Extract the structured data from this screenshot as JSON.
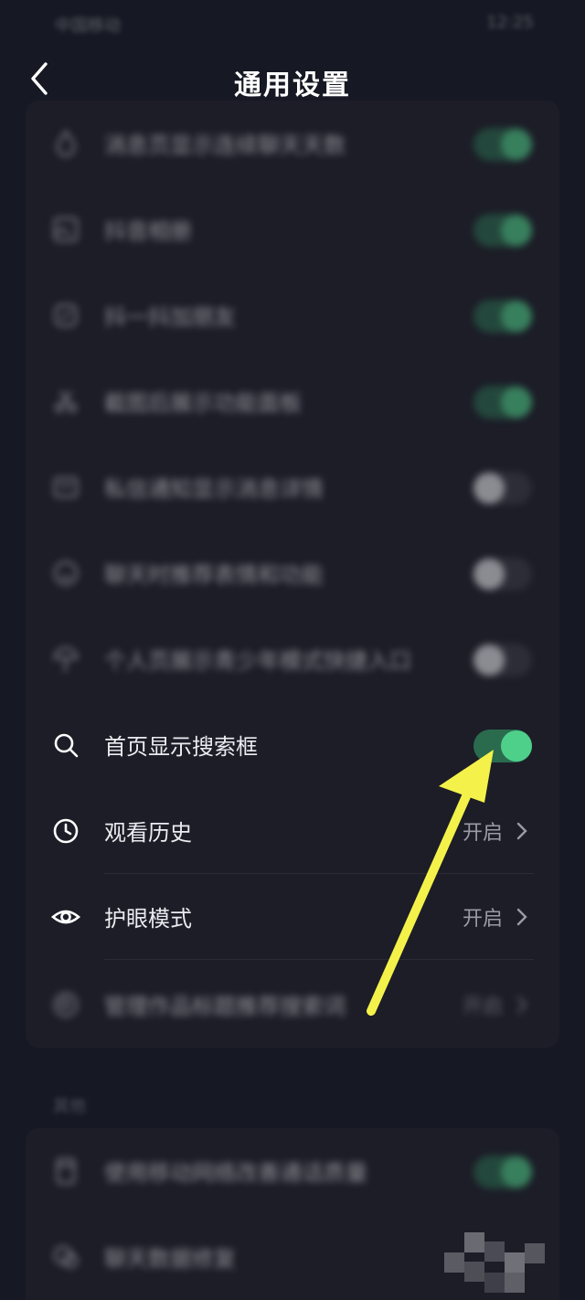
{
  "status_bar": {
    "carrier": "中国移动 ",
    "time": "12:25"
  },
  "header": {
    "title": "通用设置"
  },
  "settings": {
    "rows": [
      {
        "label": "消息页显示连续聊天天数",
        "toggle": "on",
        "icon": "flame-icon"
      },
      {
        "label": "抖音相册",
        "toggle": "on",
        "icon": "album-icon"
      },
      {
        "label": "抖一抖加朋友",
        "toggle": "on",
        "icon": "shake-icon"
      },
      {
        "label": "截图后展示功能面板",
        "toggle": "on",
        "icon": "screenshot-icon"
      },
      {
        "label": "私信通知显示消息详情",
        "toggle": "off",
        "icon": "message-icon"
      },
      {
        "label": "聊天时推荐表情和功能",
        "toggle": "off",
        "icon": "emoji-icon"
      },
      {
        "label": "个人页展示青少年模式快捷入口",
        "toggle": "off",
        "icon": "umbrella-icon"
      },
      {
        "label": "首页显示搜索框",
        "toggle": "on",
        "icon": "search-icon"
      },
      {
        "label": "观看历史",
        "value": "开启",
        "icon": "clock-icon"
      },
      {
        "label": "护眼模式",
        "value": "开启",
        "icon": "eye-icon"
      },
      {
        "label": "管理作品标题推荐搜索词",
        "value": "开启",
        "icon": "search-manage-icon"
      }
    ]
  },
  "other": {
    "header": "其他",
    "rows": [
      {
        "label": "使用移动网络改善通话质量",
        "toggle": "on",
        "icon": "sim-icon"
      },
      {
        "label": "聊天数据修复",
        "icon": "chat-icon"
      }
    ]
  },
  "colors": {
    "background": "#161823",
    "card": "#1c1d27",
    "toggle_on": "#4fd08a",
    "arrow": "#f4f24a"
  }
}
